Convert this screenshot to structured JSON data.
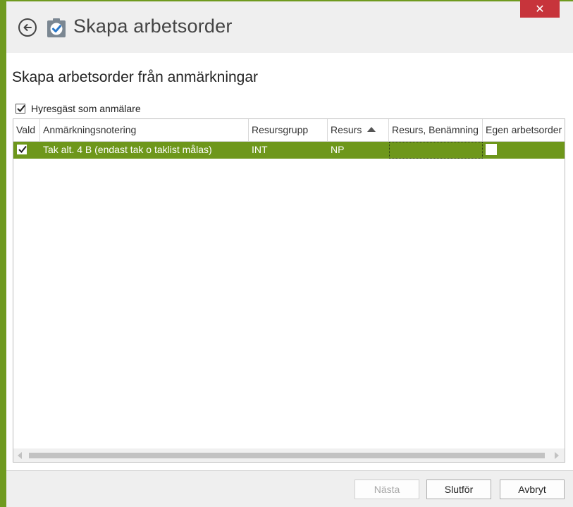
{
  "window": {
    "title": "Skapa arbetsorder",
    "close_label": "✕",
    "colors": {
      "accent": "#6f9a1f",
      "close": "#c7343b",
      "selected_row": "#6e971b"
    }
  },
  "main": {
    "heading": "Skapa arbetsorder från anmärkningar",
    "tenant_checkbox": {
      "label": "Hyresgäst som anmälare",
      "checked": true
    }
  },
  "grid": {
    "columns": [
      {
        "label": "Vald"
      },
      {
        "label": "Anmärkningsnotering"
      },
      {
        "label": "Resursgrupp"
      },
      {
        "label": "Resurs",
        "sorted": "ascending"
      },
      {
        "label": "Resurs, Benämning"
      },
      {
        "label": "Egen arbetsorder"
      }
    ],
    "rows": [
      {
        "vald": true,
        "anmarkningsnotering": "Tak alt. 4 B (endast tak o taklist målas)",
        "resursgrupp": "INT",
        "resurs": "NP",
        "resurs_benamning": "",
        "egen_arbetsorder": false
      }
    ]
  },
  "footer": {
    "next_label": "Nästa",
    "finish_label": "Slutför",
    "cancel_label": "Avbryt"
  },
  "icons": {
    "back": "back-arrow-icon",
    "app": "checklist-icon",
    "check": "check-icon",
    "sort": "sort-ascending-icon"
  }
}
